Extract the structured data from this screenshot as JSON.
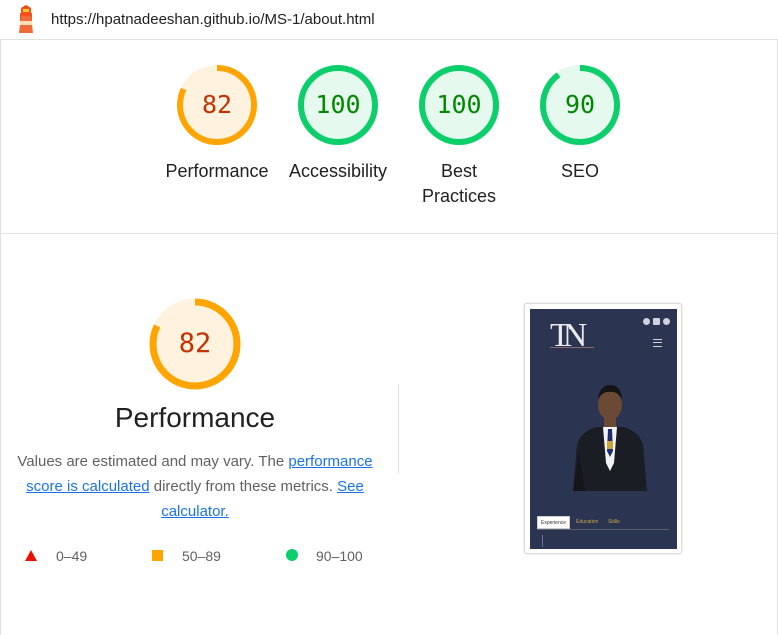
{
  "header": {
    "url": "https://hpatnadeeshan.github.io/MS-1/about.html",
    "logo_icon": "lighthouse-icon"
  },
  "gauges": [
    {
      "label": "Performance",
      "score": "82",
      "value": 0.82,
      "color": "#ffa400",
      "fill": "#fff3e0"
    },
    {
      "label": "Accessibility",
      "score": "100",
      "value": 1.0,
      "color": "#0cce6b",
      "fill": "#e6f9ee"
    },
    {
      "label": "Best Practices",
      "label_line1": "Best",
      "label_line2": "Practices",
      "score": "100",
      "value": 1.0,
      "color": "#0cce6b",
      "fill": "#e6f9ee"
    },
    {
      "label": "SEO",
      "score": "90",
      "value": 0.9,
      "color": "#0cce6b",
      "fill": "#e6f9ee"
    }
  ],
  "performance": {
    "score": "82",
    "value": 0.82,
    "title": "Performance",
    "desc_prefix": "Values are estimated and may vary. The ",
    "link1": "performance score is calculated",
    "desc_middle": " directly from these metrics. ",
    "link2": "See calculator."
  },
  "legend": [
    {
      "range": "0–49",
      "shape": "triangle",
      "color": "#eb0f00"
    },
    {
      "range": "50–89",
      "shape": "square",
      "color": "#ffa400"
    },
    {
      "range": "90–100",
      "shape": "circle",
      "color": "#0cce6b"
    }
  ],
  "screenshot": {
    "logo_text": "TN",
    "tabs": [
      "Experience",
      "Education",
      "Skills"
    ]
  }
}
